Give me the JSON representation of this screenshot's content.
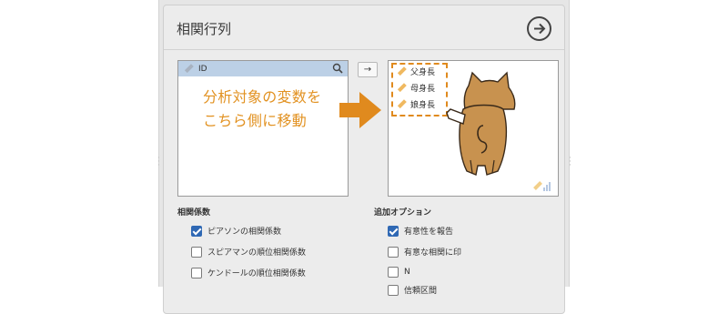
{
  "panel": {
    "title": "相関行列",
    "variables": {
      "search_item": "ID"
    },
    "move_arrow": "→",
    "selected_variables": [
      "父身長",
      "母身長",
      "娘身長"
    ]
  },
  "annotation": {
    "line1": "分析対象の変数を",
    "line2": "こちら側に移動"
  },
  "correlation": {
    "heading": "相関係数",
    "options": [
      {
        "label": "ピアソンの相関係数",
        "checked": true
      },
      {
        "label": "スピアマンの順位相関係数",
        "checked": false
      },
      {
        "label": "ケンドールの順位相関係数",
        "checked": false
      }
    ]
  },
  "additional": {
    "heading": "追加オプション",
    "options": [
      {
        "label": "有意性を報告",
        "checked": true
      },
      {
        "label": "有意な相関に印",
        "checked": false
      },
      {
        "label": "N",
        "checked": false
      },
      {
        "label": "信頼区間",
        "checked": false
      }
    ]
  },
  "colors": {
    "accent": "#e29222",
    "check": "#2f68b4",
    "header_selected": "#bcd0e6"
  }
}
